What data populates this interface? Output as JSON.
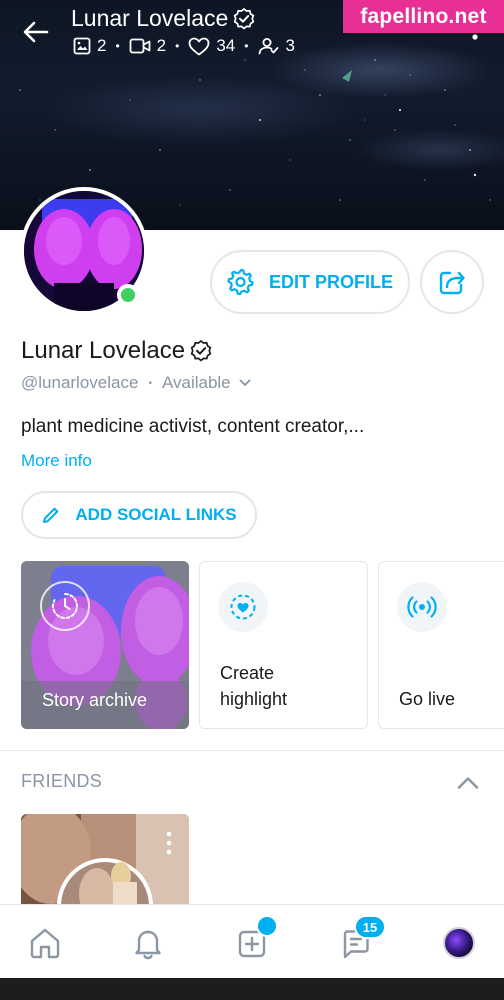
{
  "header": {
    "title": "Lunar Lovelace",
    "stats": [
      {
        "icon": "image-icon",
        "value": "2"
      },
      {
        "icon": "video-icon",
        "value": "2"
      },
      {
        "icon": "heart-icon",
        "value": "34"
      },
      {
        "icon": "fans-icon",
        "value": "3"
      }
    ],
    "separator": "•"
  },
  "watermark": "fapellino.net",
  "profile": {
    "name": "Lunar Lovelace",
    "handle": "@lunarlovelace",
    "separator": "•",
    "status": "Available",
    "bio": "plant medicine activist, content creator,...",
    "more_info": "More info"
  },
  "buttons": {
    "edit_profile": "EDIT PROFILE",
    "add_social_links": "ADD SOCIAL LINKS"
  },
  "cards": {
    "archive_label": "Story archive",
    "highlight_label_line1": "Create",
    "highlight_label_line2": "highlight",
    "live_label": "Go live"
  },
  "friends": {
    "heading": "FRIENDS"
  },
  "bottom_nav": {
    "items": [
      "home-icon",
      "bell-icon",
      "add-post-icon",
      "messages-icon",
      "avatar"
    ],
    "messages_badge": "15"
  },
  "colors": {
    "accent": "#00aff0",
    "online": "#3ed05f",
    "muted": "#8a96a3",
    "watermark_bg": "#e82f96"
  }
}
